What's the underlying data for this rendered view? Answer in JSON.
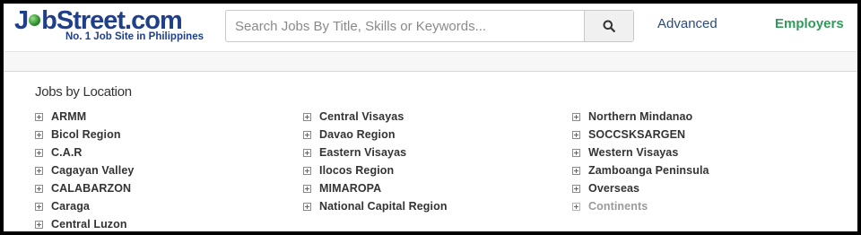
{
  "header": {
    "logo_text_pre": "J",
    "logo_text_post": "bStreet.com",
    "logo_tagline": "No. 1 Job Site in Philippines",
    "search": {
      "placeholder": "Search Jobs By Title, Skills or Keywords...",
      "value": ""
    },
    "search_button_icon": "search-icon",
    "advanced_label": "Advanced",
    "employers_label": "Employers"
  },
  "section": {
    "title": "Jobs by Location"
  },
  "locations": {
    "column1": [
      {
        "label": "ARMM"
      },
      {
        "label": "Bicol Region"
      },
      {
        "label": "C.A.R"
      },
      {
        "label": "Cagayan Valley"
      },
      {
        "label": "CALABARZON"
      },
      {
        "label": "Caraga"
      },
      {
        "label": "Central Luzon"
      }
    ],
    "column2": [
      {
        "label": "Central Visayas"
      },
      {
        "label": "Davao Region"
      },
      {
        "label": "Eastern Visayas"
      },
      {
        "label": "Ilocos Region"
      },
      {
        "label": "MIMAROPA"
      },
      {
        "label": "National Capital Region"
      }
    ],
    "column3": [
      {
        "label": "Northern Mindanao"
      },
      {
        "label": "SOCCSKSARGEN"
      },
      {
        "label": "Western Visayas"
      },
      {
        "label": "Zamboanga Peninsula"
      },
      {
        "label": "Overseas"
      },
      {
        "label": "Continents"
      }
    ]
  },
  "colors": {
    "brand_blue": "#1f3f8a",
    "employers_green": "#2f9b5a",
    "advanced_blue": "#2a4b7c",
    "muted_item": "#9a9a9a"
  }
}
